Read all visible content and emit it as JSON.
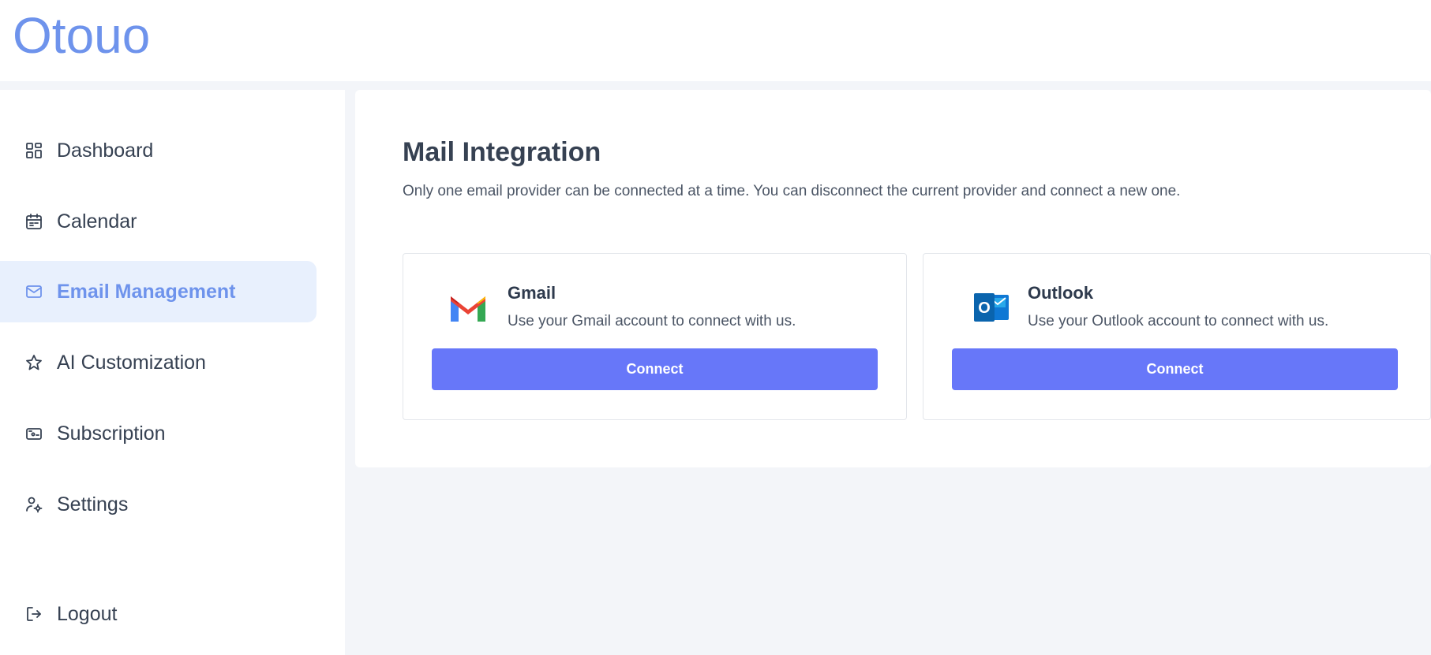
{
  "brand": {
    "name": "Otouo",
    "color": "#6e93ec"
  },
  "sidebar": {
    "items": [
      {
        "label": "Dashboard",
        "icon": "dashboard-grid-icon"
      },
      {
        "label": "Calendar",
        "icon": "calendar-icon"
      },
      {
        "label": "Email Management",
        "icon": "mail-icon",
        "active": true
      },
      {
        "label": "AI Customization",
        "icon": "star-icon"
      },
      {
        "label": "Subscription",
        "icon": "wallet-icon"
      },
      {
        "label": "Settings",
        "icon": "user-gear-icon"
      }
    ],
    "logout": {
      "label": "Logout",
      "icon": "logout-icon"
    }
  },
  "main": {
    "title": "Mail Integration",
    "subtitle": "Only one email provider can be connected at a time. You can disconnect the current provider and connect a new one.",
    "providers": [
      {
        "name": "Gmail",
        "description": "Use your Gmail account to connect with us.",
        "button": "Connect",
        "icon": "gmail-logo-icon"
      },
      {
        "name": "Outlook",
        "description": "Use your Outlook account to connect with us.",
        "button": "Connect",
        "icon": "outlook-logo-icon"
      }
    ]
  },
  "colors": {
    "accent": "#6777f9",
    "active_bg": "#e8f0fd",
    "active_text": "#6e93ec",
    "text": "#364152"
  }
}
